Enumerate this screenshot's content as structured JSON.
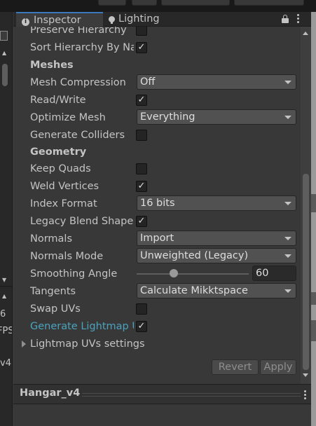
{
  "tabs": {
    "inspector_label": "Inspector",
    "lighting_label": "Lighting"
  },
  "left_panel": {
    "values": [
      "6",
      "FPS",
      "v4"
    ]
  },
  "sections": {
    "preserve_hierarchy_label": "Preserve Hierarchy",
    "sort_hierarchy_label": "Sort Hierarchy By Na",
    "meshes_header": "Meshes",
    "mesh_compression_label": "Mesh Compression",
    "mesh_compression_value": "Off",
    "read_write_label": "Read/Write",
    "optimize_mesh_label": "Optimize Mesh",
    "optimize_mesh_value": "Everything",
    "generate_colliders_label": "Generate Colliders",
    "geometry_header": "Geometry",
    "keep_quads_label": "Keep Quads",
    "weld_vertices_label": "Weld Vertices",
    "index_format_label": "Index Format",
    "index_format_value": "16 bits",
    "legacy_blend_label": "Legacy Blend Shape",
    "normals_label": "Normals",
    "normals_value": "Import",
    "normals_mode_label": "Normals Mode",
    "normals_mode_value": "Unweighted (Legacy)",
    "smoothing_angle_label": "Smoothing Angle",
    "smoothing_angle_value": "60",
    "smoothing_angle_fraction": 0.33,
    "tangents_label": "Tangents",
    "tangents_value": "Calculate Mikktspace",
    "swap_uvs_label": "Swap UVs",
    "generate_lightmap_label": "Generate Lightmap U",
    "lightmap_settings_label": "Lightmap UVs settings"
  },
  "checks": {
    "preserve_hierarchy": false,
    "sort_hierarchy": true,
    "read_write": true,
    "generate_colliders": false,
    "keep_quads": false,
    "weld_vertices": true,
    "legacy_blend": true,
    "swap_uvs": false,
    "generate_lightmap": true
  },
  "buttons": {
    "revert_label": "Revert",
    "apply_label": "Apply"
  },
  "preview": {
    "title": "Hangar_v4"
  },
  "colors": {
    "accent": "#3a79bb",
    "modified_label": "#4ba3bf",
    "panel_bg": "#383838"
  }
}
